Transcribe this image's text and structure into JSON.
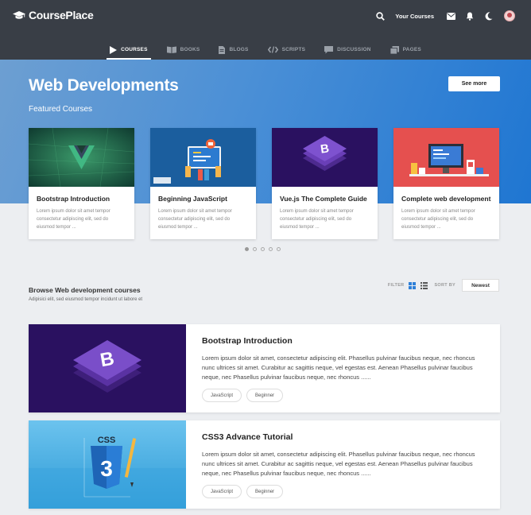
{
  "brand": {
    "name": "CoursePlace",
    "icon": "graduation-cap-icon"
  },
  "top_actions": {
    "your_courses": "Your Courses",
    "icons": [
      "search-icon",
      "mail-icon",
      "bell-icon",
      "moon-icon",
      "avatar"
    ]
  },
  "nav": {
    "items": [
      {
        "label": "COURSES",
        "icon": "play-icon",
        "active": true
      },
      {
        "label": "BOOKS",
        "icon": "book-icon",
        "active": false
      },
      {
        "label": "BLOGS",
        "icon": "document-icon",
        "active": false
      },
      {
        "label": "SCRIPTS",
        "icon": "code-icon",
        "active": false
      },
      {
        "label": "DISCUSSION",
        "icon": "chat-icon",
        "active": false
      },
      {
        "label": "PAGES",
        "icon": "pages-icon",
        "active": false
      }
    ]
  },
  "hero": {
    "title": "Web Developments",
    "subtitle": "Featured Courses",
    "see_more": "See more"
  },
  "featured": [
    {
      "title": "Bootstrap Introduction",
      "text": "Lorem ipsum dolor sit amet tempor consectetur adipiscing elit, sed do eiusmod tempor ...",
      "image": "vue-green"
    },
    {
      "title": "Beginning JavaScript",
      "text": "Lorem ipsum dolor sit amet tempor consectetur adipiscing elit, sed do eiusmod tempor ...",
      "image": "js-blue"
    },
    {
      "title": "Vue.js The Complete Guide",
      "text": "Lorem ipsum dolor sit amet tempor consectetur adipiscing elit, sed do eiusmod tempor ...",
      "image": "bootstrap-purple"
    },
    {
      "title": "Complete web development",
      "text": "Lorem ipsum dolor sit amet tempor consectetur adipiscing elit, sed do eiusmod tempor ...",
      "image": "desk-red"
    }
  ],
  "carousel": {
    "count": 5,
    "active": 0
  },
  "browse": {
    "title": "Browse Web development courses",
    "subtitle": "Adipisici elit, sed eiusmod tempor incidunt ut labore et",
    "filter_label": "FILTER",
    "sort_label": "SORT BY",
    "sort_value": "Newest"
  },
  "courses": [
    {
      "title": "Bootstrap Introduction",
      "text": "Lorem ipsum dolor sit amet, consectetur adipiscing elit. Phasellus pulvinar faucibus neque, nec rhoncus nunc ultrices sit amet. Curabitur ac sagittis neque, vel egestas est. Aenean Phasellus pulvinar faucibus neque, nec  Phasellus pulvinar faucibus neque, nec rhoncus ......",
      "tags": [
        "JavaScript",
        "Beginner"
      ],
      "image": "bootstrap-purple"
    },
    {
      "title": "CSS3 Advance Tutorial",
      "text": "Lorem ipsum dolor sit amet, consectetur adipiscing elit. Phasellus pulvinar faucibus neque, nec rhoncus nunc ultrices sit amet. Curabitur ac sagittis neque, vel egestas est. Aenean Phasellus pulvinar faucibus neque, nec  Phasellus pulvinar faucibus neque, nec rhoncus ......",
      "tags": [
        "JavaScript",
        "Beginner"
      ],
      "image": "css3-blue"
    }
  ],
  "colors": {
    "topbar": "#393e46",
    "hero_start": "#6d9fd2",
    "hero_end": "#1f76d2",
    "accent": "#2f80d8",
    "background": "#eceef1"
  }
}
